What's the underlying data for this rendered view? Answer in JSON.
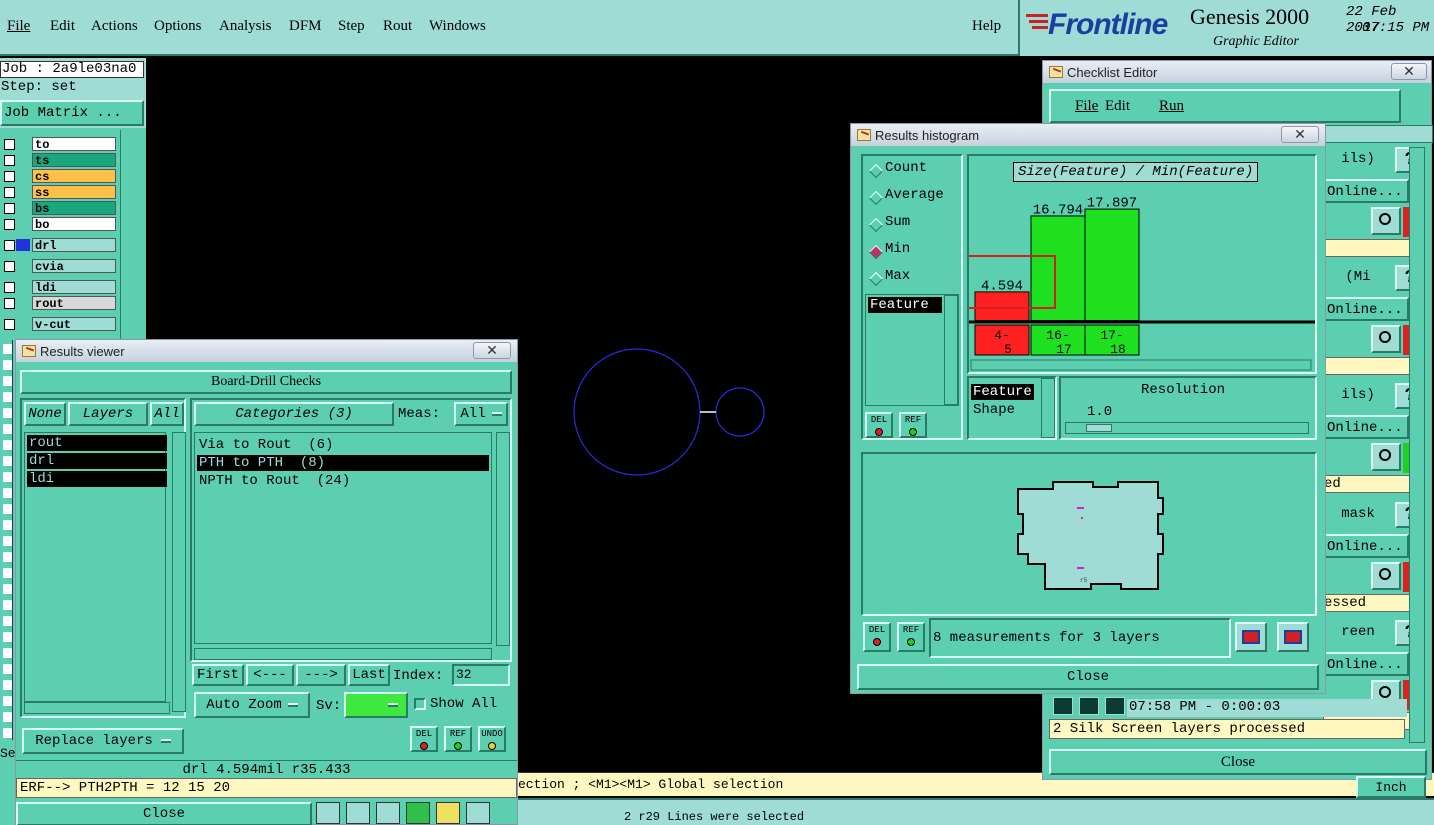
{
  "menubar": {
    "items": [
      "File",
      "Edit",
      "Actions",
      "Options",
      "Analysis",
      "DFM",
      "Step",
      "Rout",
      "Windows"
    ],
    "help": "Help"
  },
  "brand": {
    "logo": "Frontline",
    "product": "Genesis 2000",
    "subtitle": "Graphic Editor",
    "date": "22 Feb 2017",
    "time": "07:15 PM"
  },
  "left_panel": {
    "job": "Job : 2a9le03na0",
    "step": "Step: set",
    "job_matrix": "Job Matrix ...",
    "layers": [
      {
        "name": "to",
        "color": "#ffffff"
      },
      {
        "name": "ts",
        "color": "#1aa77d"
      },
      {
        "name": "cs",
        "color": "#ffc04a"
      },
      {
        "name": "ss",
        "color": "#ffc04a"
      },
      {
        "name": "bs",
        "color": "#1aa77d"
      },
      {
        "name": "bo",
        "color": "#ffffff"
      },
      {
        "name": "drl",
        "color": "#9fdcd6"
      },
      {
        "name": "cvia",
        "color": "#9fdcd6"
      },
      {
        "name": "ldi",
        "color": "#9fdcd6"
      },
      {
        "name": "rout",
        "color": "#d8d8d8"
      },
      {
        "name": "v-cut",
        "color": "#9fdcd6"
      }
    ]
  },
  "results_viewer": {
    "title": "Results viewer",
    "header": "Board-Drill Checks",
    "none_btn": "None",
    "layers_btn": "Layers",
    "all_btn": "All",
    "layers": [
      "rout",
      "drl",
      "ldi"
    ],
    "categories_btn": "Categories (3)",
    "meas_label": "Meas:",
    "meas_value": "All",
    "categories": [
      {
        "label": "Via to Rout  (6)",
        "selected": false
      },
      {
        "label": "PTH to PTH  (8)",
        "selected": true
      },
      {
        "label": "NPTH to Rout  (24)",
        "selected": false
      }
    ],
    "first": "First",
    "prev": "<---",
    "next": "--->",
    "last": "Last",
    "index_label": "Index:",
    "index_value": "32",
    "auto_zoom": "Auto Zoom",
    "sv_label": "Sv:",
    "show_all": "Show All",
    "replace_layers": "Replace layers",
    "del": "DEL",
    "ref": "REF",
    "undo": "UNDO",
    "status": "drl 4.594mil  r35.433",
    "erf": "ERF--> PTH2PTH = 12 15 20",
    "close": "Close"
  },
  "results_histogram": {
    "title": "Results histogram",
    "options": [
      {
        "label": "Count",
        "on": false
      },
      {
        "label": "Average",
        "on": false
      },
      {
        "label": "Sum",
        "on": false
      },
      {
        "label": "Min",
        "on": true
      },
      {
        "label": "Max",
        "on": false
      }
    ],
    "feature_label": "Feature",
    "chart_title": "Size(Feature) / Min(Feature)",
    "del": "DEL",
    "ref": "REF",
    "group_options": [
      "Feature",
      "Shape"
    ],
    "resolution_label": "Resolution",
    "resolution_value": "1.0",
    "measurements": "8 measurements for 3 layers",
    "close": "Close"
  },
  "chart_data": {
    "type": "bar",
    "title": "Size(Feature) / Min(Feature)",
    "categories": [
      "4-5",
      "16-17",
      "17-18"
    ],
    "values": [
      4.594,
      16.794,
      17.897
    ],
    "value_labels": [
      "4.594",
      "16.794",
      "17.897"
    ],
    "colors": [
      "#ff2020",
      "#1fe01f",
      "#1fe01f"
    ],
    "ylim": [
      0,
      20
    ]
  },
  "checklist": {
    "title": "Checklist Editor",
    "menu": [
      "File",
      "Edit",
      "Run"
    ],
    "fragments": [
      "ils)",
      "Online...",
      "(Mi",
      "Online...",
      "ils)",
      "Online...",
      "ed",
      "mask",
      "Online...",
      "essed",
      "reen",
      "Online..."
    ],
    "time_row": "07:58 PM - 0:00:03",
    "status_row": "2 Silk Screen layers processed",
    "close": "Close",
    "units": "Inch"
  },
  "status_bar": {
    "selection_hint": "ection ; <M1><M1> Global selection",
    "selected": "2 r29 Lines were selected",
    "sel_prefix": "Se"
  }
}
